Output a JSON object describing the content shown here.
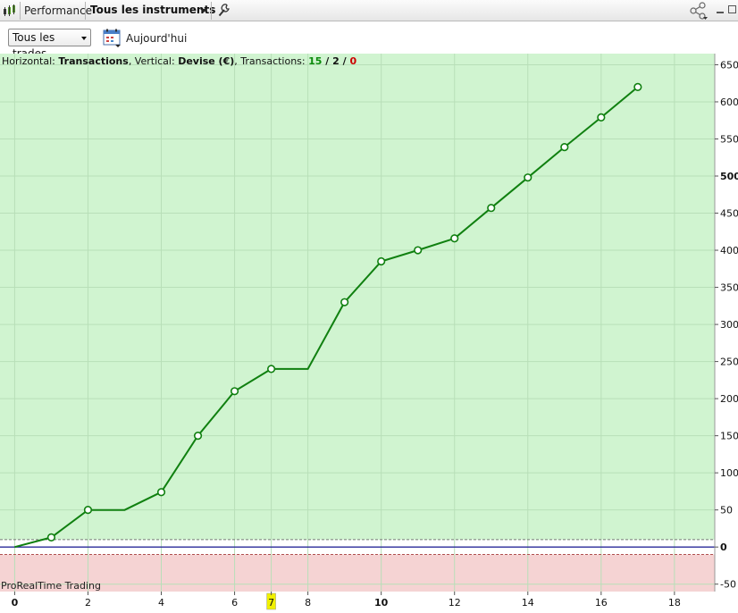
{
  "titlebar": {
    "title": "Performance",
    "instruments_label": "Tous les instruments"
  },
  "toolbar": {
    "trades_filter": "Tous les trades",
    "date_label": "Aujourd'hui"
  },
  "legend": {
    "horizontal_prefix": "Horizontal: ",
    "horizontal_value": "Transactions",
    "vertical_prefix": ", Vertical: ",
    "vertical_value": "Devise (€)",
    "transactions_prefix": ", Transactions: ",
    "count_win": "15",
    "sep1": " / ",
    "count_neutral": "2",
    "sep2": " / ",
    "count_loss": "0"
  },
  "footer": {
    "brand": "ProRealTime Trading"
  },
  "colors": {
    "positive_zone": "#d0f4d0",
    "negative_zone": "#f5d3d3",
    "line": "#108010",
    "grid": "#b8dfb8",
    "highlight_tick": "#f0f000"
  },
  "chart_data": {
    "type": "line",
    "x": [
      0,
      1,
      2,
      3,
      4,
      5,
      6,
      7,
      8,
      9,
      10,
      11,
      12,
      13,
      14,
      15,
      16,
      17
    ],
    "y": [
      0,
      13,
      50,
      50,
      74,
      150,
      210,
      240,
      240,
      330,
      385,
      400,
      416,
      457,
      498,
      539,
      579,
      620
    ],
    "markers": [
      1,
      2,
      4,
      5,
      6,
      7,
      9,
      10,
      11,
      12,
      13,
      14,
      15,
      16,
      17
    ],
    "xlim": [
      -0.4,
      19.1
    ],
    "ylim": [
      -60,
      665
    ],
    "xticks": [
      {
        "v": 0,
        "label": "0",
        "bold": true
      },
      {
        "v": 2,
        "label": "2"
      },
      {
        "v": 4,
        "label": "4"
      },
      {
        "v": 6,
        "label": "6"
      },
      {
        "v": 7,
        "label": "7",
        "highlight": true
      },
      {
        "v": 8,
        "label": "8"
      },
      {
        "v": 10,
        "label": "10",
        "bold": true
      },
      {
        "v": 12,
        "label": "12"
      },
      {
        "v": 14,
        "label": "14"
      },
      {
        "v": 16,
        "label": "16"
      },
      {
        "v": 18,
        "label": "18"
      }
    ],
    "yticks": [
      {
        "v": 650,
        "label": "650"
      },
      {
        "v": 600,
        "label": "600"
      },
      {
        "v": 550,
        "label": "550"
      },
      {
        "v": 500,
        "label": "500",
        "bold": true
      },
      {
        "v": 450,
        "label": "450"
      },
      {
        "v": 400,
        "label": "400"
      },
      {
        "v": 350,
        "label": "350"
      },
      {
        "v": 300,
        "label": "300"
      },
      {
        "v": 250,
        "label": "250"
      },
      {
        "v": 200,
        "label": "200"
      },
      {
        "v": 150,
        "label": "150"
      },
      {
        "v": 100,
        "label": "100"
      },
      {
        "v": 50,
        "label": "50"
      },
      {
        "v": 0,
        "label": "0",
        "bold": true
      },
      {
        "v": -50,
        "label": "-50"
      }
    ],
    "zone_boundary_upper": 10,
    "zone_boundary_lower": -10
  }
}
